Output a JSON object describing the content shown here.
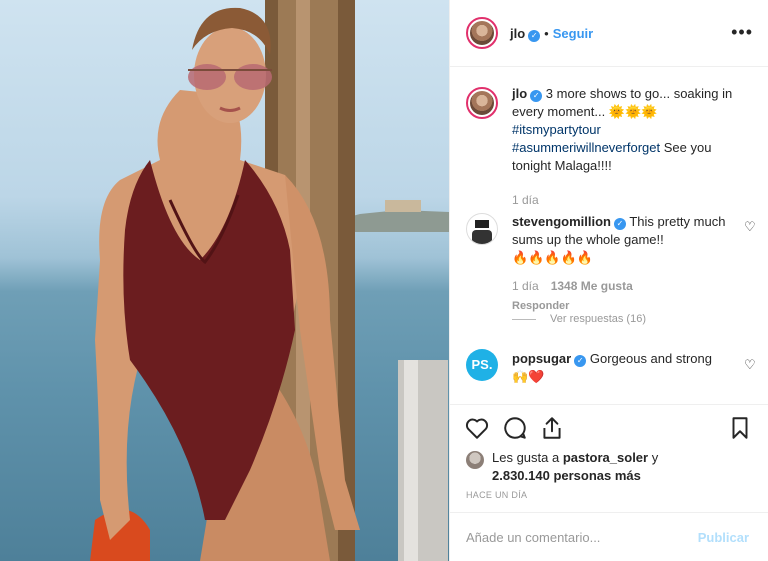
{
  "header": {
    "username": "jlo",
    "follow_label": "Seguir",
    "more_label": "•••"
  },
  "caption": {
    "username": "jlo",
    "text": "3 more shows to go... soaking in every moment...",
    "emoji": "🌞🌞🌞",
    "hashtag1": "#itsmypartytour",
    "hashtag2": "#asummeriwillneverforget",
    "tail": " See you tonight Malaga!!!!",
    "time": "1 día"
  },
  "comments": [
    {
      "username": "stevengomillion",
      "text": "This pretty much sums up the whole game!!",
      "emoji": "🔥🔥🔥🔥🔥",
      "time": "1 día",
      "likes": "1348 Me gusta",
      "reply": "Responder",
      "view_replies": "Ver respuestas (16)"
    },
    {
      "username": "popsugar",
      "avatar_text": "PS.",
      "text": "Gorgeous and strong",
      "emoji": "🙌❤️"
    }
  ],
  "likes": {
    "prefix": "Les gusta a ",
    "user": "pastora_soler",
    "middle": " y",
    "count": "2.830.140 personas más"
  },
  "timestamp": "HACE UN DÍA",
  "add_comment": {
    "placeholder": "Añade un comentario...",
    "publish_label": "Publicar"
  },
  "colors": {
    "link_blue": "#3897f0",
    "hashtag": "#003569",
    "swimsuit": "#6b1d1f"
  }
}
